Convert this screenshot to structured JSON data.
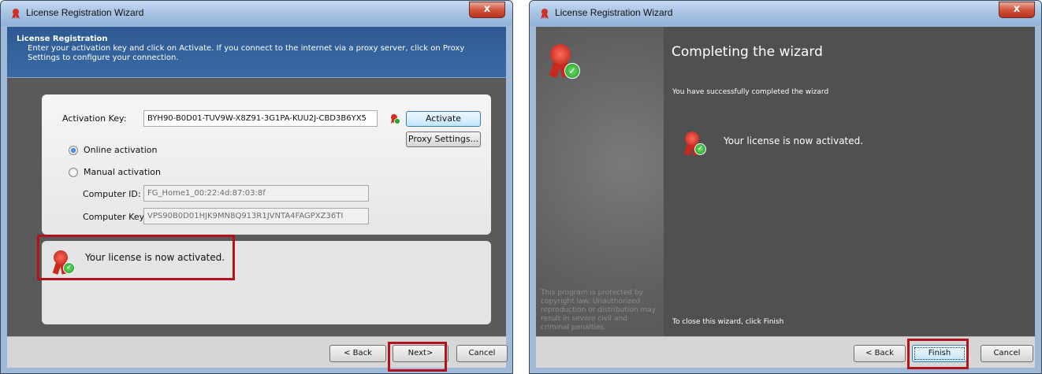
{
  "left_window": {
    "title": "License Registration Wizard",
    "close_label": "x",
    "header": {
      "title": "License Registration",
      "description": "Enter your activation key and click on Activate. If you connect to the internet via a proxy server, click on Proxy Settings to configure your connection."
    },
    "activation_key_label": "Activation Key:",
    "activation_key_value": "BYH90-B0D01-TUV9W-X8Z91-3G1PA-KUU2J-CBD3B6YX5",
    "activate_label": "Activate",
    "proxy_label": "Proxy Settings...",
    "online_label": "Online activation",
    "manual_label": "Manual activation",
    "computer_id_label": "Computer ID:",
    "computer_id_value": "FG_Home1_00:22:4d:87:03:8f",
    "computer_key_label": "Computer Key:",
    "computer_key_value": "VPS90B0D01HJK9MN8Q913R1JVNTA4FAGPXZ36TI",
    "status_message": "Your license is now activated.",
    "back_label": "< Back",
    "next_label": "Next>",
    "cancel_label": "Cancel"
  },
  "right_window": {
    "title": "License Registration Wizard",
    "close_label": "x",
    "heading": "Completing the wizard",
    "success_text": "You have successfully completed the wizard",
    "status_message": "Your license is now activated.",
    "close_hint": "To close this wizard, click Finish",
    "copyright_text": "This program is protected by copyright law. Unauthorized reproduction or distribution may result in severe civil and criminal penalties.",
    "back_label": "< Back",
    "finish_label": "Finish",
    "cancel_label": "Cancel"
  },
  "colors": {
    "highlight": "#b3121d",
    "header_blue": "#2e5a92",
    "content_gray": "#5a5a5a"
  },
  "icons": [
    "license-seal-icon",
    "close-icon",
    "radio-icon",
    "check-icon"
  ]
}
